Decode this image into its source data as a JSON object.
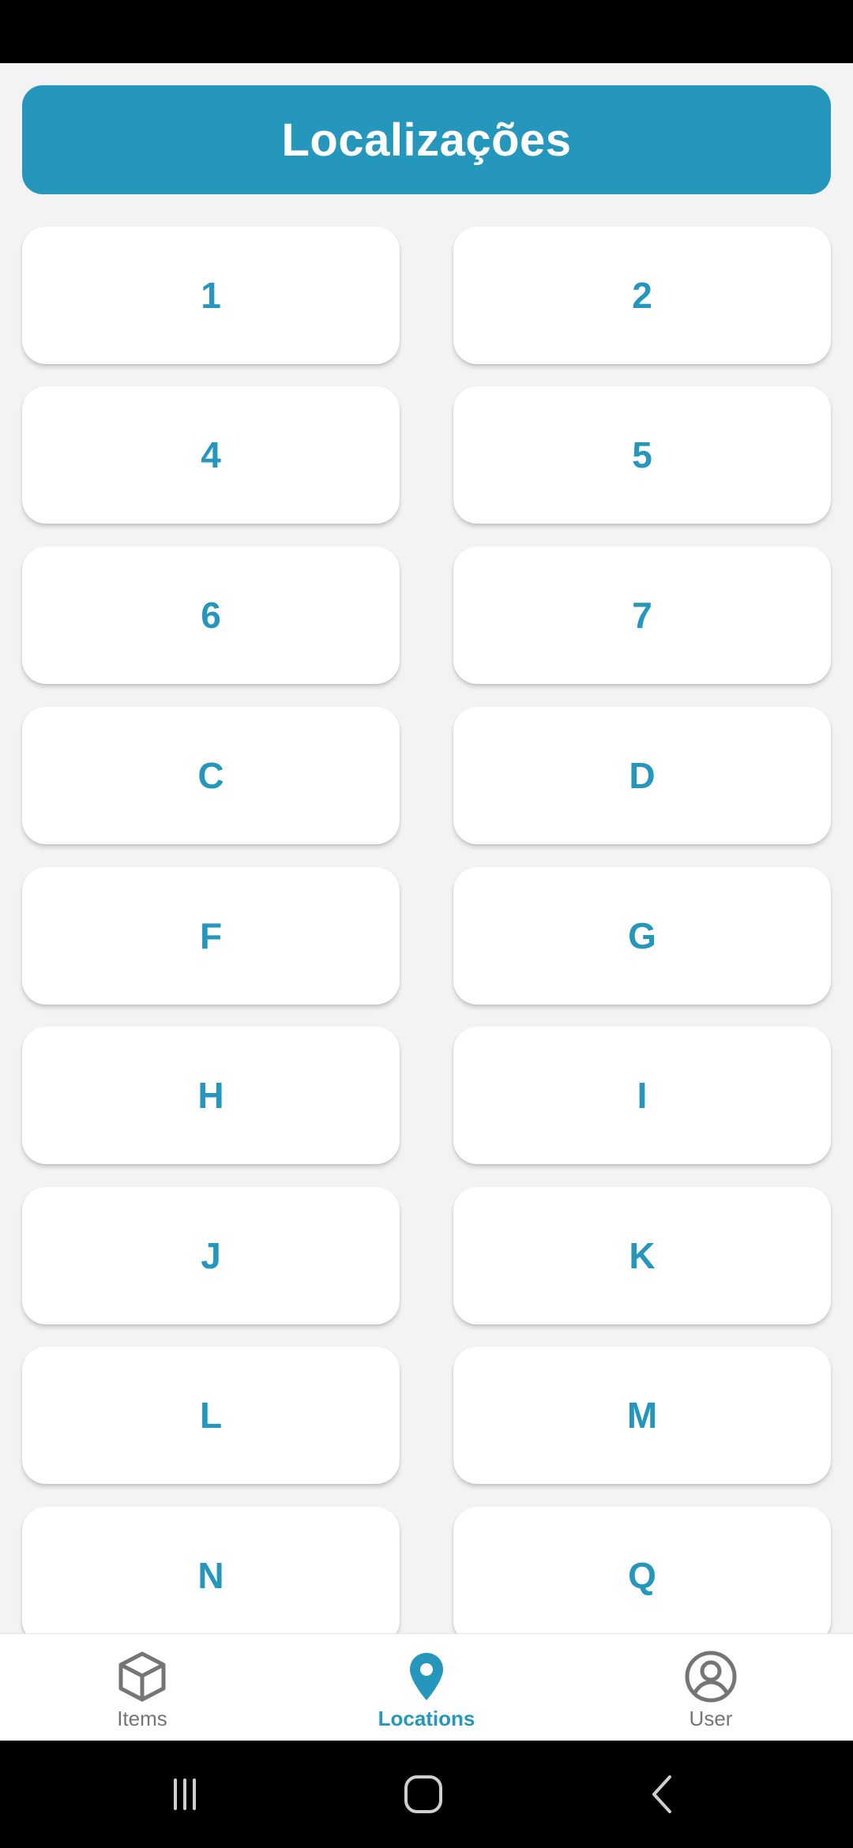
{
  "header": {
    "title": "Localizações"
  },
  "locations": [
    "1",
    "2",
    "4",
    "5",
    "6",
    "7",
    "C",
    "D",
    "F",
    "G",
    "H",
    "I",
    "J",
    "K",
    "L",
    "M",
    "N",
    "Q"
  ],
  "bottom_nav": {
    "items": [
      {
        "label": "Items",
        "icon": "cube-icon",
        "active": false
      },
      {
        "label": "Locations",
        "icon": "location-pin-icon",
        "active": true
      },
      {
        "label": "User",
        "icon": "user-circle-icon",
        "active": false
      }
    ]
  },
  "system_nav": {
    "buttons": [
      "recent-apps-icon",
      "home-icon",
      "back-icon"
    ]
  },
  "colors": {
    "accent": "#2596bc",
    "background": "#f3f3f3",
    "card": "#ffffff",
    "inactive": "#757575"
  }
}
